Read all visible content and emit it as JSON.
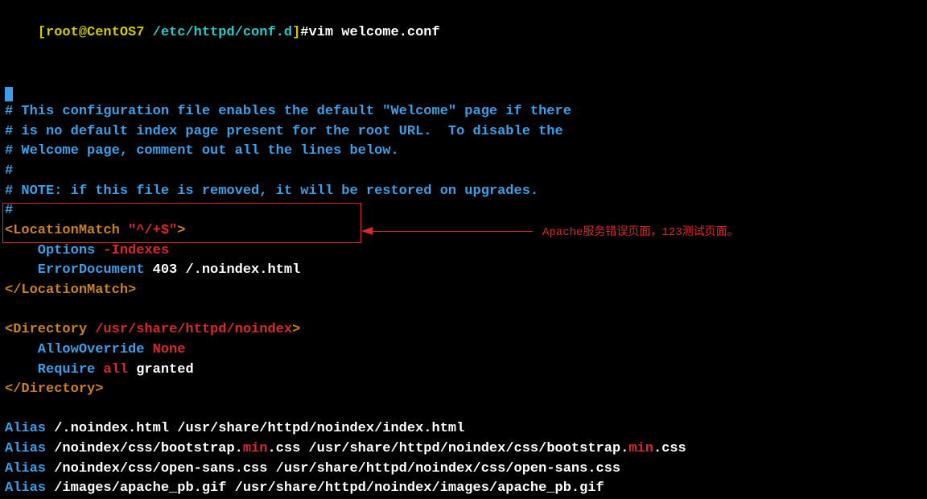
{
  "prompt": {
    "user_host": "[root@CentOS7 ",
    "cwd": "/etc/httpd/conf.d",
    "bracket_end": "]",
    "hash": "#",
    "command": "vim welcome.conf"
  },
  "lines": {
    "blank": "",
    "c1": "# This configuration file enables the default \"Welcome\" page if there",
    "c2": "# is no default index page present for the root URL.  To disable the",
    "c3": "# Welcome page, comment out all the lines below.",
    "c4": "#",
    "c5": "# NOTE: if this file is removed, it will be restored on upgrades.",
    "c6": "#",
    "lm_open_a": "<LocationMatch ",
    "lm_open_b": "\"^/+$\"",
    "lm_open_c": ">",
    "opt_a": "    Options ",
    "opt_b": "-Indexes",
    "err_a": "    ErrorDocument ",
    "err_b": "403 /.noindex.html",
    "lm_close": "</LocationMatch>",
    "dir_open_a": "<Directory ",
    "dir_open_b": "/usr/share/httpd/noindex",
    "dir_open_c": ">",
    "ao_a": "    AllowOverride ",
    "ao_b": "None",
    "rq_a": "    Require ",
    "rq_b": "all",
    "rq_c": " granted",
    "dir_close": "</Directory>",
    "a1_a": "Alias",
    "a1_b": " /.noindex.html /usr/share/httpd/noindex/index.html",
    "a2_a": "Alias",
    "a2_b": " /noindex/css/bootstrap.",
    "a2_c": "min",
    "a2_d": ".css /usr/share/httpd/noindex/css/bootstrap.",
    "a2_e": "min",
    "a2_f": ".css",
    "a3_a": "Alias",
    "a3_b": " /noindex/css/open-sans.css /usr/share/httpd/noindex/css/open-sans.css",
    "a4_a": "Alias",
    "a4_b": " /images/apache_pb.gif /usr/share/httpd/noindex/images/apache_pb.gif"
  },
  "annotation": "Apache服务错误页面，123测试页面。"
}
